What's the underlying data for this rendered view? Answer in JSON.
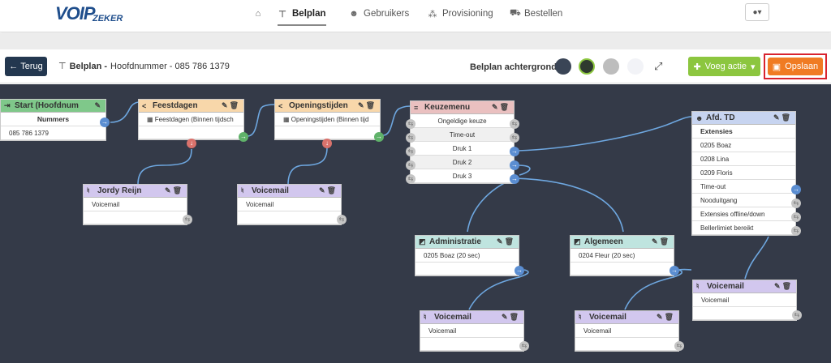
{
  "nav": {
    "logo_main": "VOIP",
    "logo_sub": "ZEKER",
    "items": [
      {
        "label": ""
      },
      {
        "label": "Belplan"
      },
      {
        "label": "Gebruikers"
      },
      {
        "label": "Provisioning"
      },
      {
        "label": "Bestellen"
      }
    ]
  },
  "toolbar": {
    "back_label": "Terug",
    "crumb_bold": "Belplan -",
    "crumb_text": "Hoofdnummer - 085 786 1379",
    "bg_label": "Belplan achtergrond",
    "swatches": [
      "#3a4556",
      "#2f3a2f",
      "#bdbdbd",
      "#f2f3f7"
    ],
    "add_label": "Voeg actie",
    "save_label": "Opslaan"
  },
  "nodes": {
    "start": {
      "title": "Start (Hoofdnum",
      "header": "Nummers",
      "number": "085 786 1379"
    },
    "feestdagen": {
      "title": "Feestdagen",
      "row": "Feestdagen (Binnen tijdsch"
    },
    "openingstijden": {
      "title": "Openingstijden",
      "row": "Openingstijden (Binnen tijd"
    },
    "keuzemenu": {
      "title": "Keuzemenu",
      "rows": [
        "Ongeldige keuze",
        "Time-out",
        "Druk 1",
        "Druk 2",
        "Druk 3"
      ]
    },
    "afd_td": {
      "title": "Afd. TD",
      "header": "Extensies",
      "rows": [
        "0205 Boaz",
        "0208 Lina",
        "0209 Floris",
        "Time-out",
        "Nooduitgang",
        "Extensies offline/down",
        "Bellerlimiet bereikt"
      ]
    },
    "vm_jordy": {
      "title": "Jordy Reijn",
      "row": "Voicemail"
    },
    "vm_1": {
      "title": "Voicemail",
      "row": "Voicemail"
    },
    "administratie": {
      "title": "Administratie",
      "row": "0205 Boaz (20 sec)"
    },
    "algemeen": {
      "title": "Algemeen",
      "row": "0204 Fleur (20 sec)"
    },
    "vm_2": {
      "title": "Voicemail",
      "row": "Voicemail"
    },
    "vm_3": {
      "title": "Voicemail",
      "row": "Voicemail"
    },
    "vm_4": {
      "title": "Voicemail",
      "row": "Voicemail"
    }
  },
  "colors": {
    "canvas": "#343a48",
    "wire": "#6ea7e0",
    "save": "#f07b23",
    "save_highlight": "#d9232e",
    "add": "#8cc63f",
    "back": "#23374f"
  }
}
